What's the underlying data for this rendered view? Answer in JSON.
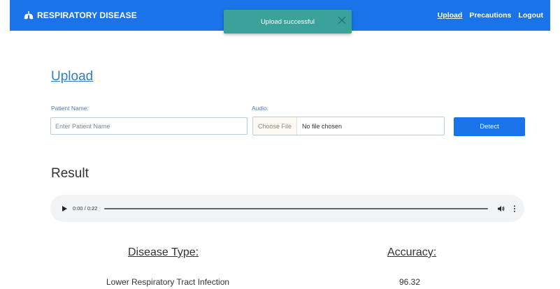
{
  "header": {
    "brand": "RESPIRATORY DISEASE",
    "brand_icon": "lungs-icon",
    "nav": [
      {
        "label": "Upload",
        "active": true
      },
      {
        "label": "Precautions",
        "active": false
      },
      {
        "label": "Logout",
        "active": false
      }
    ],
    "color": "#1a73e8"
  },
  "toast": {
    "message": "Upload successful",
    "close_icon": "close-icon",
    "color": "#3aa29a"
  },
  "upload": {
    "title": "Upload",
    "patient_label": "Patient Name:",
    "patient_placeholder": "Enter Patient Name",
    "patient_value": "",
    "audio_label": "Audio:",
    "file_button": "Choose File",
    "file_status": "No file chosen",
    "detect_label": "Detect"
  },
  "result": {
    "title": "Result",
    "audio": {
      "time": "0:00 / 0:22",
      "progress": 0
    },
    "disease_header": "Disease Type:",
    "accuracy_header": "Accuracy:",
    "disease_value": "Lower Respiratory Tract Infection",
    "accuracy_value": "96.32"
  }
}
